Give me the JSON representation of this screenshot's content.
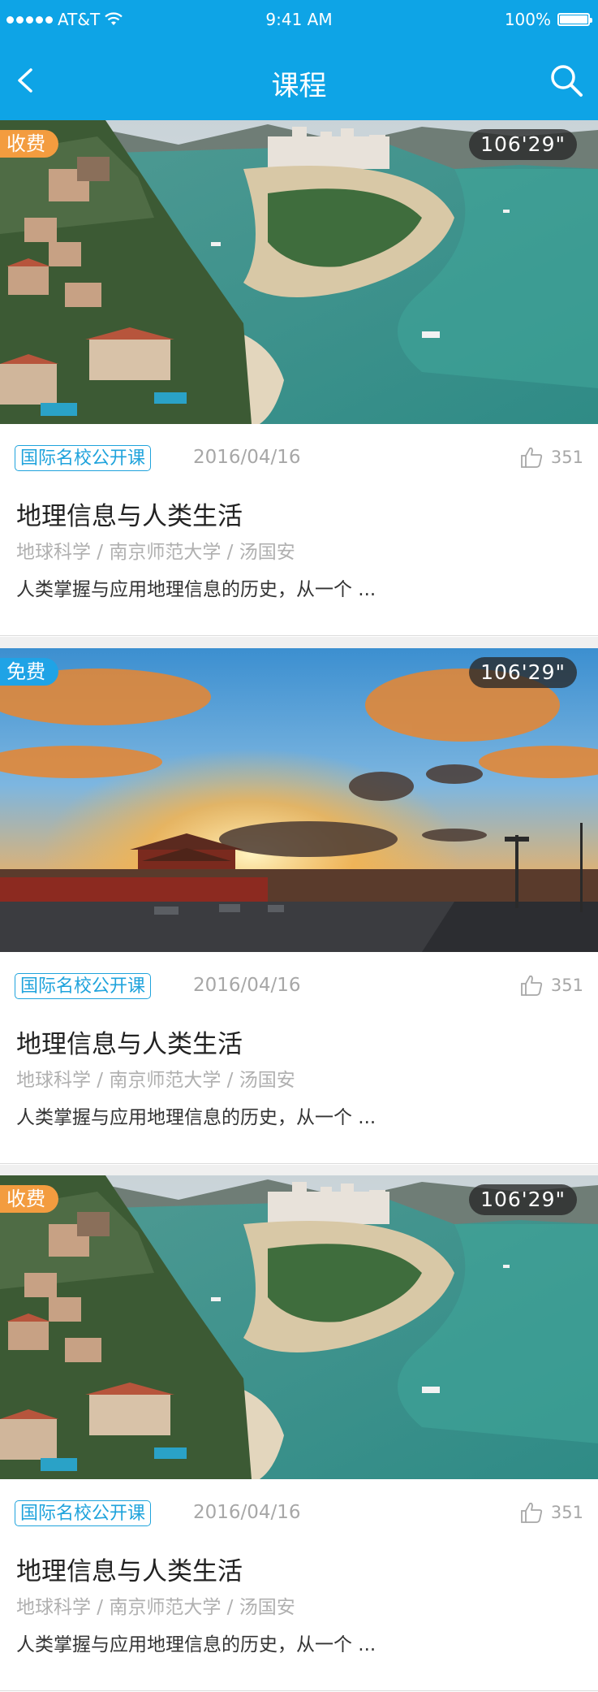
{
  "status_bar": {
    "carrier": "AT&T",
    "time": "9:41 AM",
    "battery": "100%"
  },
  "nav": {
    "title": "课程"
  },
  "courses": [
    {
      "price_badge": "收费",
      "price_color": "#f39c3f",
      "duration": "106'29\"",
      "image": "coastal-city-aerial",
      "category": "国际名校公开课",
      "date": "2016/04/16",
      "likes": "351",
      "title": "地理信息与人类生活",
      "subtitle": "地球科学 / 南京师范大学 / 汤国安",
      "description": "人类掌握与应用地理信息的历史，从一个 ..."
    },
    {
      "price_badge": "免费",
      "price_color": "#1fa3e6",
      "duration": "106'29\"",
      "image": "tiananmen-sunset",
      "category": "国际名校公开课",
      "date": "2016/04/16",
      "likes": "351",
      "title": "地理信息与人类生活",
      "subtitle": "地球科学 / 南京师范大学 / 汤国安",
      "description": "人类掌握与应用地理信息的历史，从一个 ..."
    },
    {
      "price_badge": "收费",
      "price_color": "#f39c3f",
      "duration": "106'29\"",
      "image": "coastal-city-aerial",
      "category": "国际名校公开课",
      "date": "2016/04/16",
      "likes": "351",
      "title": "地理信息与人类生活",
      "subtitle": "地球科学 / 南京师范大学 / 汤国安",
      "description": "人类掌握与应用地理信息的历史，从一个 ..."
    }
  ]
}
